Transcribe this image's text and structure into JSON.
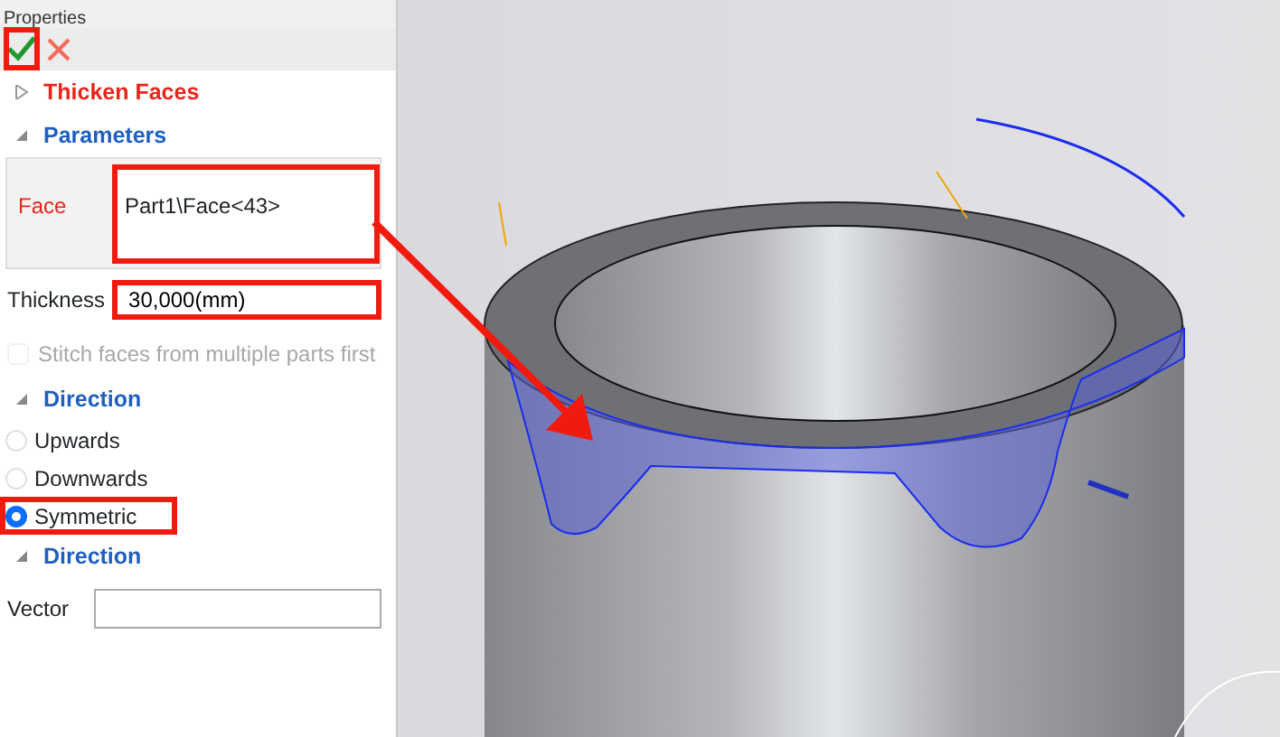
{
  "panel": {
    "title": "Properties",
    "actions": [
      {
        "kind": "ok",
        "highlighted": true
      },
      {
        "kind": "cancel",
        "highlighted": false
      }
    ],
    "rows": [
      {
        "kind": "section",
        "label": "Thicken Faces",
        "expanded": false,
        "color": "#e8251c"
      },
      {
        "kind": "section",
        "label": "Parameters",
        "expanded": true,
        "color": "#1f5fbf"
      },
      {
        "kind": "face",
        "label": "Face",
        "value": "Part1\\Face<43>",
        "highlighted": true
      },
      {
        "kind": "field",
        "label": "Thickness",
        "value": "30,000(mm)",
        "highlighted": true
      },
      {
        "kind": "checkbox",
        "label": "Stitch faces from multiple parts first",
        "checked": false,
        "disabled": true
      },
      {
        "kind": "section",
        "label": "Direction",
        "expanded": true,
        "color": "#1f5fbf"
      },
      {
        "kind": "radio",
        "label": "Upwards",
        "selected": false,
        "highlighted": false
      },
      {
        "kind": "radio",
        "label": "Downwards",
        "selected": false,
        "highlighted": false
      },
      {
        "kind": "radio",
        "label": "Symmetric",
        "selected": true,
        "highlighted": true
      },
      {
        "kind": "section",
        "label": "Direction",
        "expanded": true,
        "color": "#1f5fbf"
      },
      {
        "kind": "field",
        "label": "Vector",
        "value": "",
        "highlighted": false
      }
    ]
  }
}
